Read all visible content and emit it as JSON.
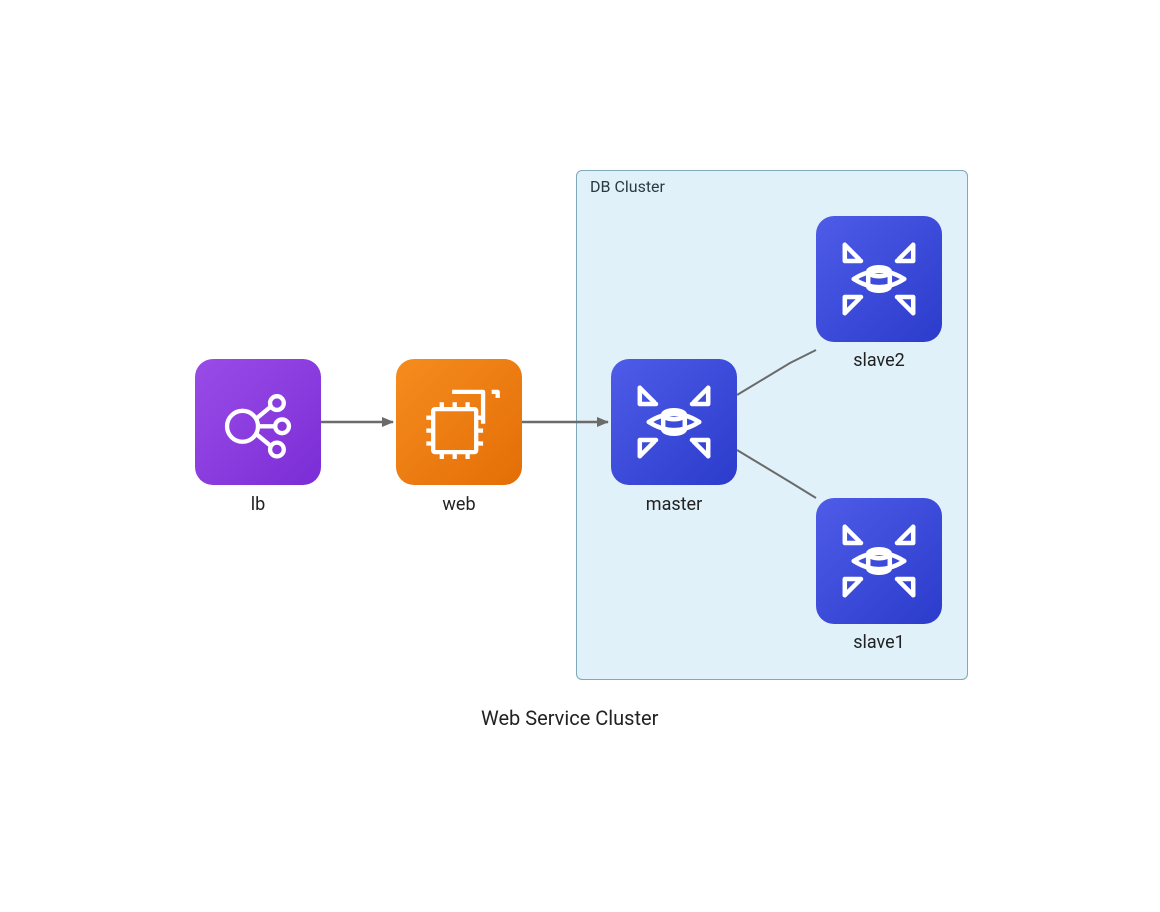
{
  "title": "Web Service Cluster",
  "cluster": {
    "label": "DB Cluster"
  },
  "nodes": {
    "lb": {
      "label": "lb"
    },
    "web": {
      "label": "web"
    },
    "master": {
      "label": "master"
    },
    "slave1": {
      "label": "slave1"
    },
    "slave2": {
      "label": "slave2"
    }
  },
  "colors": {
    "lb": "#8C3BE8",
    "web": "#ED7B0F",
    "db": "#3B49D6",
    "cluster_bg": "#E0F1FA",
    "cluster_border": "#7FA8B8",
    "arrow": "#6B6B6B"
  },
  "edges": [
    {
      "from": "lb",
      "to": "web",
      "style": "arrow"
    },
    {
      "from": "web",
      "to": "master",
      "style": "arrow"
    },
    {
      "from": "master",
      "to": "slave2",
      "style": "line"
    },
    {
      "from": "master",
      "to": "slave1",
      "style": "line"
    }
  ]
}
